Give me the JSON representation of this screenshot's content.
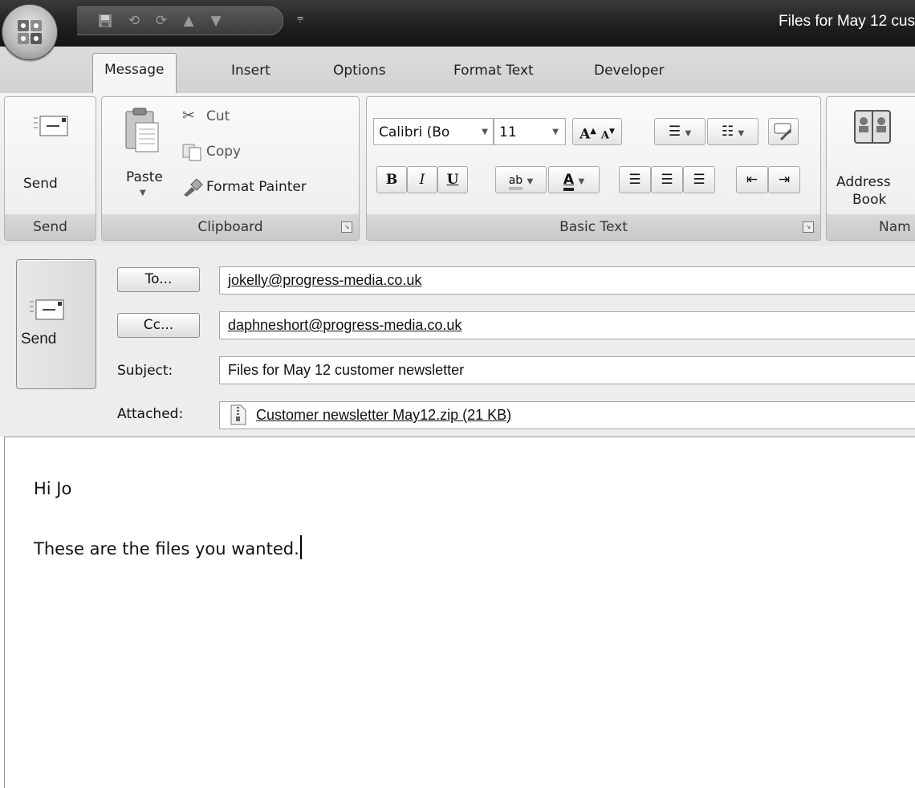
{
  "window": {
    "title": "Files for May 12 cus"
  },
  "quick_access": {
    "icons": [
      "save-icon",
      "undo-icon",
      "redo-icon",
      "previous-item-icon",
      "next-item-icon"
    ],
    "customize_glyph": "⩦"
  },
  "tabs": [
    {
      "label": "Message",
      "active": true
    },
    {
      "label": "Insert",
      "active": false
    },
    {
      "label": "Options",
      "active": false
    },
    {
      "label": "Format Text",
      "active": false
    },
    {
      "label": "Developer",
      "active": false
    }
  ],
  "ribbon": {
    "send_group": {
      "button": "Send",
      "label": "Send"
    },
    "clipboard": {
      "label": "Clipboard",
      "paste": "Paste",
      "cut": "Cut",
      "copy": "Copy",
      "format_painter": "Format Painter"
    },
    "basic_text": {
      "label": "Basic Text",
      "font_name": "Calibri (Bo",
      "font_size": "11",
      "bold": "B",
      "italic": "I",
      "underline": "U",
      "highlight": "ab",
      "font_color": "A",
      "grow_font": "A",
      "shrink_font": "A"
    },
    "names": {
      "label": "Nam",
      "address_book_line1": "Address",
      "address_book_line2": "Book"
    }
  },
  "header": {
    "send_label": "Send",
    "to_button": "To...",
    "to_value": "jokelly@progress-media.co.uk",
    "cc_button": "Cc...",
    "cc_value": "daphneshort@progress-media.co.uk",
    "subject_label": "Subject:",
    "subject_value": "Files for May 12 customer newsletter",
    "attached_label": "Attached:",
    "attachment": "Customer newsletter May12.zip (21 KB)"
  },
  "body": {
    "line1": "Hi Jo",
    "line2": "These are the files you wanted."
  }
}
